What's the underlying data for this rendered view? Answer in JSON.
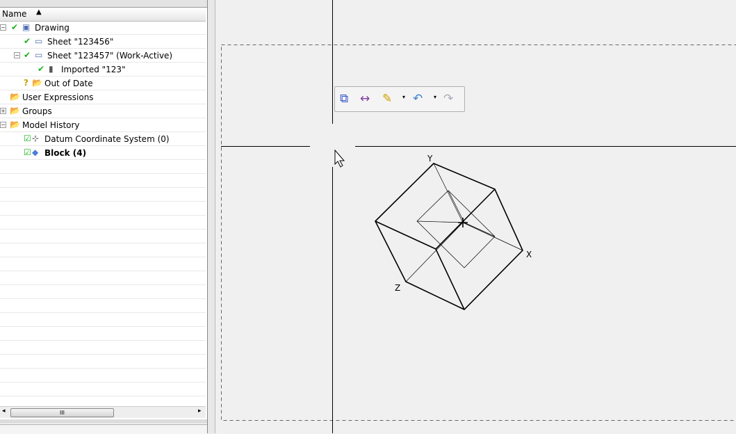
{
  "tree": {
    "header": "Name",
    "rows": [
      {
        "label": "Drawing",
        "icon": "drawing-icon",
        "check": true,
        "expander": "−"
      },
      {
        "label": "Sheet \"123456\"",
        "icon": "sheet-icon",
        "check": true
      },
      {
        "label": "Sheet \"123457\" (Work-Active)",
        "icon": "sheet-icon",
        "check": true,
        "expander": "−"
      },
      {
        "label": "Imported \"123\"",
        "icon": "imported-view-icon",
        "check": true
      },
      {
        "label": "Out of Date",
        "icon": "folder-icon",
        "status": "?"
      },
      {
        "label": "User Expressions",
        "icon": "folder-icon"
      },
      {
        "label": "Groups",
        "icon": "folder-icon",
        "expander": "+"
      },
      {
        "label": "Model History",
        "icon": "folder-icon",
        "expander": "−"
      },
      {
        "label": "Datum Coordinate System (0)",
        "icon": "datum-csys-icon",
        "checkbox": true
      },
      {
        "label": "Block (4)",
        "icon": "block-icon",
        "checkbox": true
      }
    ],
    "scroll_thumb": "III"
  },
  "toolbar": {
    "items": [
      "view-layout-icon",
      "measure-distance-icon",
      "paint-brush-icon",
      "undo-icon",
      "redo-icon"
    ]
  },
  "canvas": {
    "axes": {
      "x": "X",
      "y": "Y",
      "z": "Z"
    }
  }
}
